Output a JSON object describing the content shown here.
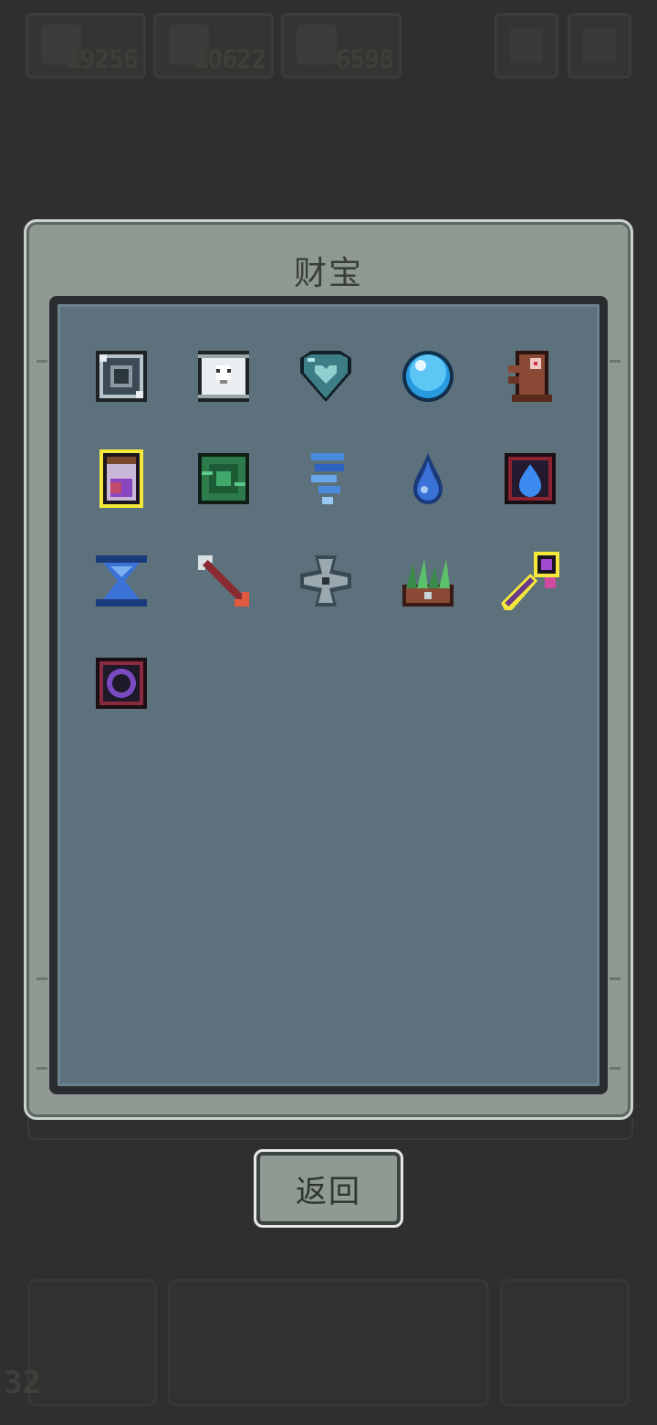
{
  "hud": {
    "resources": [
      {
        "icon": "gear-icon",
        "value": "19256"
      },
      {
        "icon": "creature-icon",
        "value": "10622"
      },
      {
        "icon": "wand-icon",
        "value": "6598"
      }
    ]
  },
  "panel": {
    "title": "财宝",
    "items": [
      {
        "name": "metal-crate-icon"
      },
      {
        "name": "skull-scroll-icon"
      },
      {
        "name": "heart-gem-icon"
      },
      {
        "name": "blue-orb-icon"
      },
      {
        "name": "totem-idol-icon"
      },
      {
        "name": "potion-jar-icon",
        "highlight": "#f4e93a"
      },
      {
        "name": "vortex-tile-icon"
      },
      {
        "name": "tornado-icon"
      },
      {
        "name": "water-drop-icon"
      },
      {
        "name": "fire-tile-icon"
      },
      {
        "name": "hourglass-icon"
      },
      {
        "name": "arrow-icon"
      },
      {
        "name": "shuriken-icon"
      },
      {
        "name": "grass-block-icon"
      },
      {
        "name": "magic-key-icon",
        "highlight": "#f4e93a"
      },
      {
        "name": "portal-ring-icon"
      }
    ]
  },
  "back_button": {
    "label": "返回"
  },
  "footer": {
    "level": "32"
  }
}
